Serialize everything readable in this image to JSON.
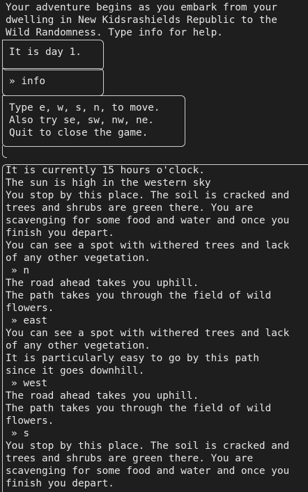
{
  "intro": [
    "Your adventure begins as you embark from your",
    "dwelling in New Kidsrashields Republic to the",
    "Wild Randomness. Type info for help."
  ],
  "day_box": [
    "It is day 1."
  ],
  "command_box": [
    "» info"
  ],
  "help_box": [
    "Type e, w, s, n, to move.",
    "Also try se, sw, nw, ne.",
    "Quit to close the game."
  ],
  "log": [
    "It is currently 15 hours o'clock.",
    "The sun is high in the western sky",
    "You stop by this place. The soil is cracked and",
    "trees and shrubs are green there. You are",
    "scavenging for some food and water and once you",
    "finish you depart.",
    "You can see a spot with withered trees and lack",
    "of any other vegetation.",
    "» n",
    "The road ahead takes you uphill.",
    "The path takes you through the field of wild",
    "flowers.",
    "» east",
    "You can see a spot with withered trees and lack",
    "of any other vegetation.",
    "It is particularly easy to go by this path",
    "since it goes downhill.",
    "» west",
    "The road ahead takes you uphill.",
    "The path takes you through the field of wild",
    "flowers.",
    "» s",
    "You stop by this place. The soil is cracked and",
    "trees and shrubs are green there. You are",
    "scavenging for some food and water and once you",
    "finish you depart."
  ]
}
